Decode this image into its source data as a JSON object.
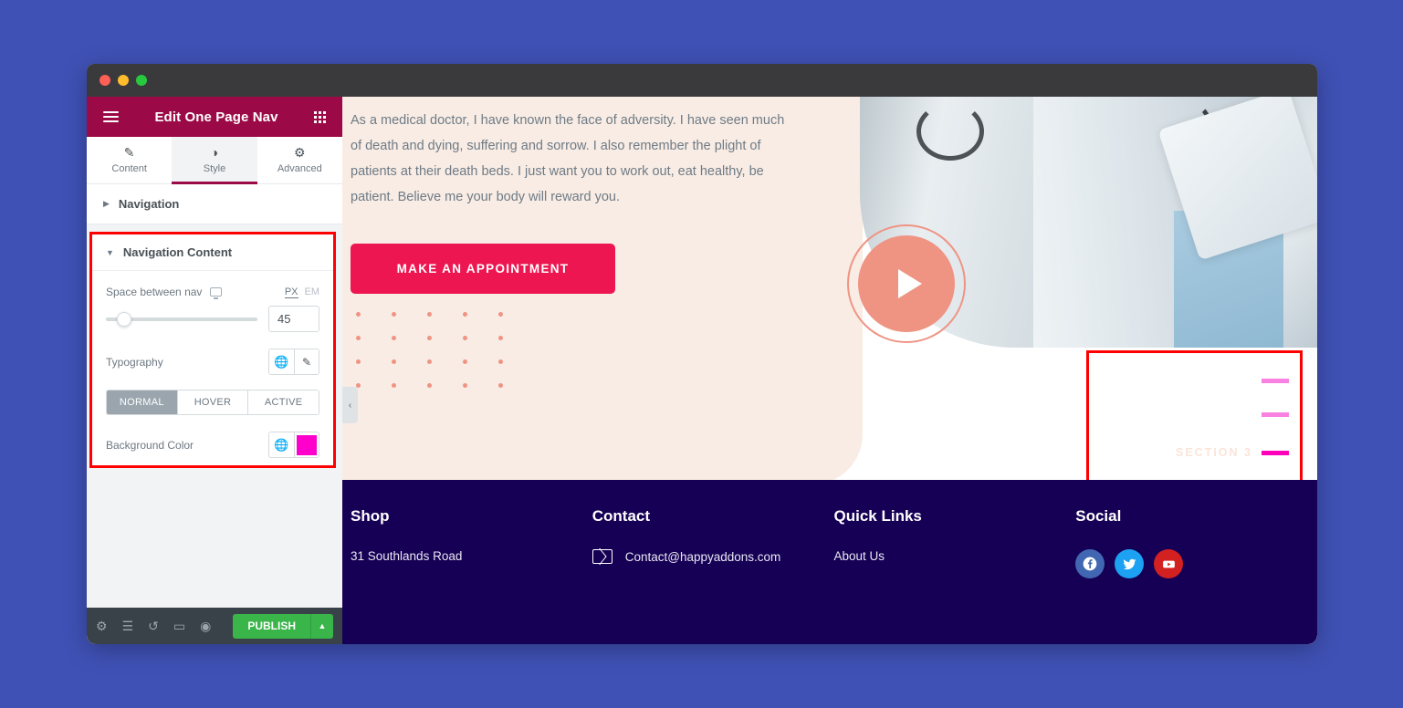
{
  "app": {
    "panel_title": "Edit One Page Nav",
    "menu_icon": "hamburger-icon",
    "grid_icon": "grid-apps-icon"
  },
  "tabs": [
    {
      "label": "Content",
      "icon": "pencil-icon",
      "glyph": "✎",
      "active": false
    },
    {
      "label": "Style",
      "icon": "contrast-icon",
      "glyph": "◑",
      "active": true
    },
    {
      "label": "Advanced",
      "icon": "gear-icon",
      "glyph": "⚙",
      "active": false
    }
  ],
  "sections": {
    "navigation": {
      "label": "Navigation",
      "caret": "▶",
      "expanded": false
    },
    "navigation_content": {
      "label": "Navigation Content",
      "caret": "▼",
      "expanded": true
    }
  },
  "controls": {
    "space_between_nav": {
      "label": "Space between nav",
      "device_icon": "desktop-icon",
      "units": [
        {
          "label": "PX",
          "active": true
        },
        {
          "label": "EM",
          "active": false
        }
      ],
      "value": "45",
      "slider_percent": 12
    },
    "typography": {
      "label": "Typography",
      "globe_icon": "globe-icon",
      "edit_icon": "pencil-icon"
    },
    "states": [
      {
        "label": "NORMAL",
        "active": true
      },
      {
        "label": "HOVER",
        "active": false
      },
      {
        "label": "ACTIVE",
        "active": false
      }
    ],
    "background_color": {
      "label": "Background Color",
      "globe_icon": "globe-icon",
      "swatch_hex": "#ff00cc"
    }
  },
  "panel_footer": {
    "icons": [
      {
        "name": "settings-gear-icon",
        "glyph": "⚙"
      },
      {
        "name": "navigator-layers-icon",
        "glyph": "☰"
      },
      {
        "name": "history-icon",
        "glyph": "↺"
      },
      {
        "name": "responsive-mode-icon",
        "glyph": "▭"
      },
      {
        "name": "preview-eye-icon",
        "glyph": "◉"
      }
    ],
    "publish_label": "PUBLISH",
    "publish_arrow": "▲",
    "publish_color": "#39b54a"
  },
  "collapse_handle": {
    "icon": "chevron-left-icon",
    "glyph": "‹"
  },
  "canvas": {
    "hero_paragraph": "As a medical doctor, I have known the face of adversity. I have seen much of death and dying, suffering and sorrow. I also remember the plight of patients at their death beds. I just want you to work out, eat healthy, be patient. Believe me your body will reward you.",
    "appointment_button": "MAKE AN APPOINTMENT",
    "play_button_icon": "play-triangle-icon",
    "accent_colors": {
      "cream": "#f8ece4",
      "cta_pink": "#ed1651",
      "salmon": "#ef9483",
      "footer_navy": "#160055",
      "highlight_red": "#ff0000"
    }
  },
  "section_nav": [
    {
      "label": "",
      "active": false,
      "dash_color": "#f981e2"
    },
    {
      "label": "",
      "active": false,
      "dash_color": "#f981e2"
    },
    {
      "label": "SECTION 3",
      "active": true,
      "dash_color": "#ff00bb"
    }
  ],
  "footer": {
    "columns": [
      {
        "heading": "Shop",
        "items": [
          {
            "icon": "",
            "text": "31 Southlands Road"
          }
        ]
      },
      {
        "heading": "Contact",
        "items": [
          {
            "icon": "mail-icon",
            "text": "Contact@happyaddons.com"
          }
        ]
      },
      {
        "heading": "Quick Links",
        "items": [
          {
            "icon": "",
            "text": "About Us"
          }
        ]
      },
      {
        "heading": "Social",
        "items": [],
        "socials": [
          {
            "name": "facebook-icon",
            "color": "#4267b2"
          },
          {
            "name": "twitter-icon",
            "color": "#1da1f2"
          },
          {
            "name": "youtube-icon",
            "color": "#d32020"
          }
        ]
      }
    ]
  }
}
